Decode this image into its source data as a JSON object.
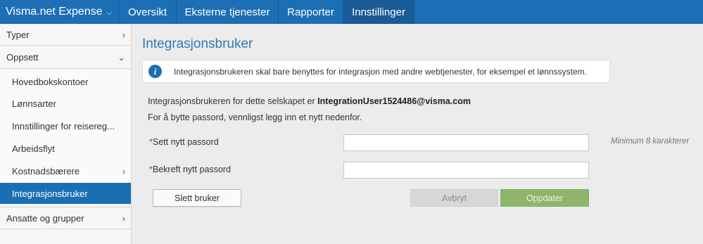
{
  "topnav": {
    "brand": "Visma.net Expense",
    "tabs": [
      {
        "label": "Oversikt"
      },
      {
        "label": "Eksterne tjenester"
      },
      {
        "label": "Rapporter"
      },
      {
        "label": "Innstillinger"
      }
    ]
  },
  "sidebar": {
    "groups": [
      {
        "label": "Typer"
      },
      {
        "label": "Oppsett"
      },
      {
        "label": "Ansatte og grupper"
      }
    ],
    "items": [
      {
        "label": "Hovedbokskontoer"
      },
      {
        "label": "Lønnsarter"
      },
      {
        "label": "Innstillinger for reisereg..."
      },
      {
        "label": "Arbeidsflyt"
      },
      {
        "label": "Kostnadsbærere"
      },
      {
        "label": "Integrasjonsbruker"
      }
    ]
  },
  "main": {
    "title": "Integrasjonsbruker",
    "info": "Integrasjonsbrukeren skal bare benyttes for integrasjon med andre webtjenester, for eksempel et lønnssystem.",
    "line1_prefix": "Integrasjonsbrukeren for dette selskapet er",
    "user_email": "IntegrationUser1524486@visma.com",
    "line2": "For å bytte passord, vennligst legg inn et nytt nedenfor.",
    "fields": {
      "required_mark": "*",
      "new_password_label": "Sett nytt passord",
      "new_password_value": "",
      "confirm_password_label": "Bekreft nytt passord",
      "confirm_password_value": "",
      "hint": "Minimum 8 karakterer"
    },
    "buttons": {
      "delete": "Slett bruker",
      "cancel": "Avbryt",
      "update": "Oppdater"
    }
  },
  "colors": {
    "nav_bg": "#1c6fb4",
    "accent": "#1a6fb3",
    "title": "#2e79b8",
    "update_button": "#8fb56b",
    "required": "#c0392b"
  }
}
